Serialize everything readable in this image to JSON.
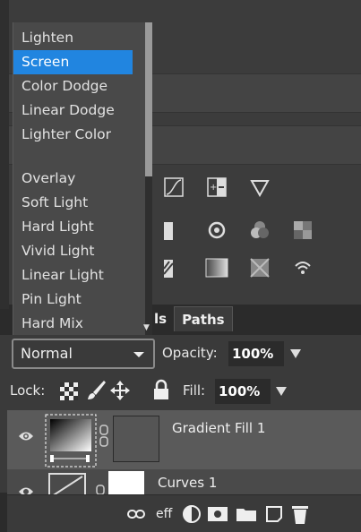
{
  "blend_menu": {
    "items": [
      {
        "label": "Lighten",
        "selected": false
      },
      {
        "label": "Screen",
        "selected": true
      },
      {
        "label": "Color Dodge",
        "selected": false
      },
      {
        "label": "Linear Dodge",
        "selected": false
      },
      {
        "label": "Lighter Color",
        "selected": false
      },
      {
        "label": "Overlay",
        "selected": false
      },
      {
        "label": "Soft Light",
        "selected": false
      },
      {
        "label": "Hard Light",
        "selected": false
      },
      {
        "label": "Vivid Light",
        "selected": false
      },
      {
        "label": "Linear Light",
        "selected": false
      },
      {
        "label": "Pin Light",
        "selected": false
      },
      {
        "label": "Hard Mix",
        "selected": false
      }
    ]
  },
  "tabs": {
    "layers_partial": "ls",
    "paths": "Paths"
  },
  "layer_props": {
    "blend_mode": "Normal",
    "opacity_label": "Opacity:",
    "opacity_value": "100%",
    "lock_label": "Lock:",
    "fill_label": "Fill:",
    "fill_value": "100%"
  },
  "layers": [
    {
      "name": "Gradient Fill 1",
      "selected": true
    },
    {
      "name": "Curves 1",
      "selected": false
    }
  ],
  "bottom_icons": {
    "effects_label": "eff"
  },
  "colors": {
    "selection": "#2185e0",
    "panel": "#3a3a3a",
    "layer_selected": "#5a5a5a"
  }
}
